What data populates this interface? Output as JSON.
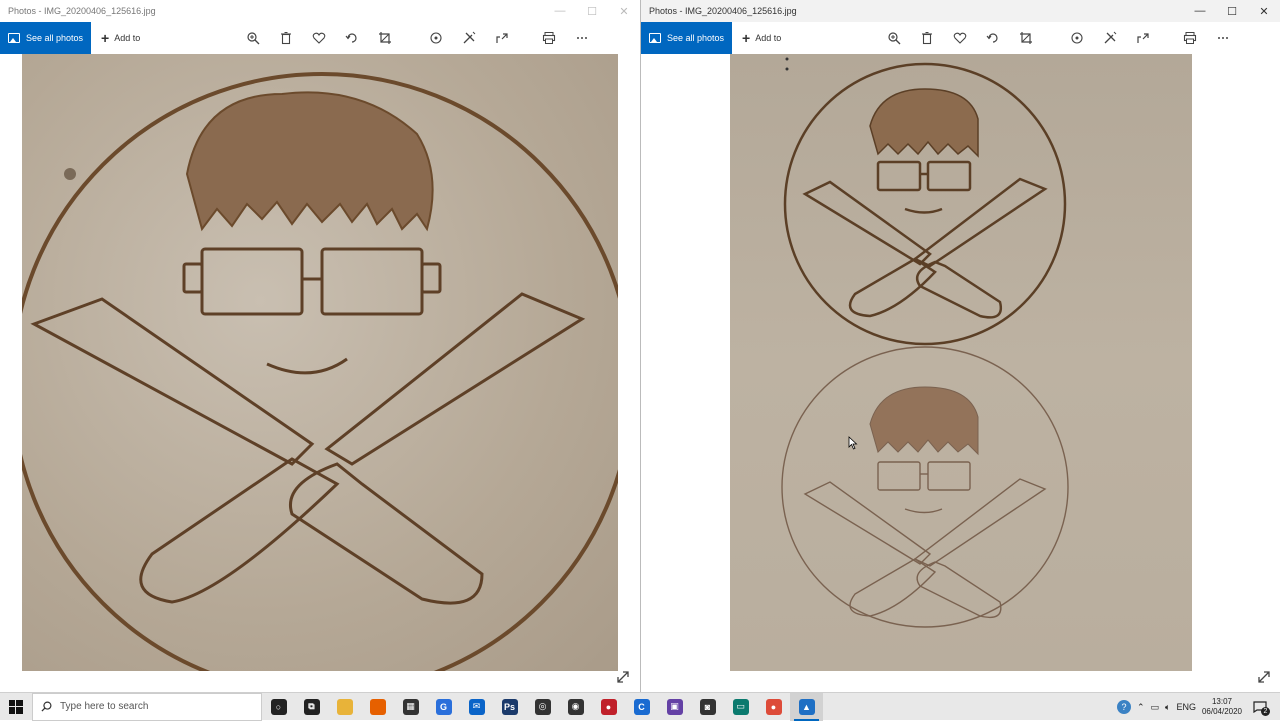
{
  "left_window": {
    "title": "Photos - IMG_20200406_125616.jpg",
    "see_all": "See all photos",
    "add_to": "Add to"
  },
  "right_window": {
    "title": "Photos - IMG_20200406_125616.jpg",
    "see_all": "See all photos",
    "add_to": "Add to"
  },
  "caption": {
    "minimize": "—",
    "maximize": "☐",
    "close": "✕"
  },
  "toolbar_icons": [
    "zoom-icon",
    "delete-icon",
    "heart-icon",
    "rotate-icon",
    "crop-icon",
    "enhance-icon",
    "edit-icon",
    "share-icon",
    "print-icon",
    "more-icon"
  ],
  "taskbar": {
    "search_placeholder": "Type here to search",
    "apps": [
      {
        "name": "cortana",
        "color": "#222222",
        "glyph": "○"
      },
      {
        "name": "task-view",
        "color": "#222222",
        "glyph": "⧉"
      },
      {
        "name": "file-explorer",
        "color": "#e8b339",
        "glyph": ""
      },
      {
        "name": "firefox",
        "color": "#e66000",
        "glyph": ""
      },
      {
        "name": "calculator",
        "color": "#333333",
        "glyph": "▦"
      },
      {
        "name": "app-g",
        "color": "#2a6fdb",
        "glyph": "G"
      },
      {
        "name": "mail",
        "color": "#0a64c8",
        "glyph": "✉"
      },
      {
        "name": "photoshop",
        "color": "#1b3a6b",
        "glyph": "Ps"
      },
      {
        "name": "gamepad",
        "color": "#333333",
        "glyph": "◎"
      },
      {
        "name": "obs",
        "color": "#333333",
        "glyph": "◉"
      },
      {
        "name": "app-red",
        "color": "#c0202a",
        "glyph": "●"
      },
      {
        "name": "app-c",
        "color": "#1a6bd1",
        "glyph": "C"
      },
      {
        "name": "twitch",
        "color": "#6441a5",
        "glyph": "▣"
      },
      {
        "name": "camera",
        "color": "#333333",
        "glyph": "◙"
      },
      {
        "name": "terminal",
        "color": "#0b7a6e",
        "glyph": "▭"
      },
      {
        "name": "chrome",
        "color": "#dd4b39",
        "glyph": "●"
      },
      {
        "name": "photos",
        "color": "#1e6fc4",
        "glyph": "▲"
      }
    ],
    "tray": {
      "lang": "ENG",
      "time": "13:07",
      "date": "06/04/2020",
      "notifications": "2"
    }
  }
}
